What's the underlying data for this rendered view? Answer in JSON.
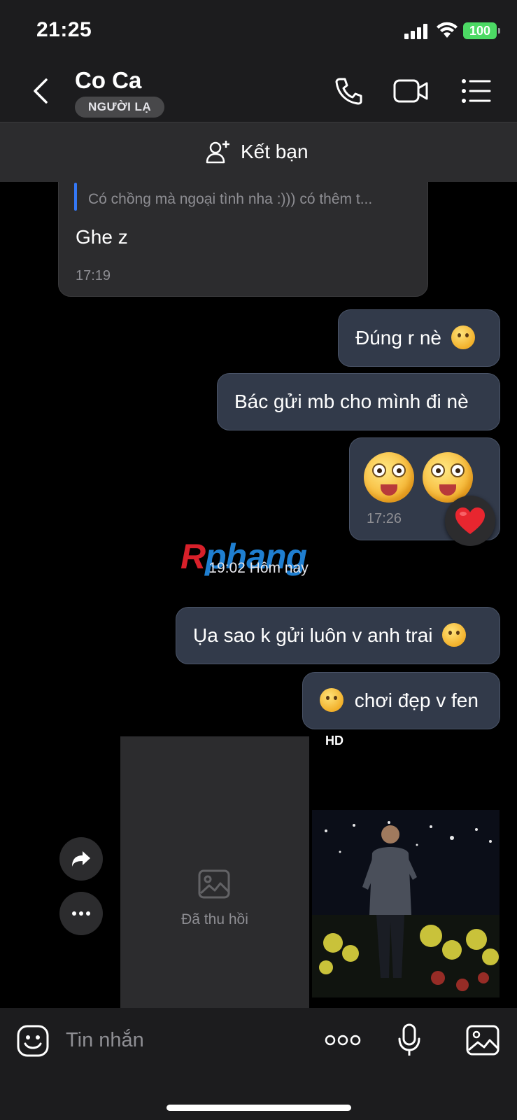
{
  "status_bar": {
    "time": "21:25",
    "battery": "100"
  },
  "header": {
    "contact_name": "Co Ca",
    "badge": "NGƯỜI LẠ",
    "icons": [
      "back-icon",
      "phone-icon",
      "video-call-icon",
      "menu-list-icon"
    ]
  },
  "add_friend": {
    "label": "Kết bạn",
    "icon": "add-person-icon"
  },
  "messages": {
    "incoming": {
      "quote": "Có chồng mà ngoại tình nha :))) có thêm t...",
      "text": "Ghe z",
      "time": "17:19"
    },
    "outgoing_1": {
      "text": "Đúng r nè",
      "emoji": "shushing-face"
    },
    "outgoing_2": {
      "text": "Bác gửi mb cho mình đi nè"
    },
    "outgoing_3": {
      "emojis": [
        "drooling-face",
        "drooling-face"
      ],
      "time": "17:26",
      "reaction": "heart"
    },
    "date_separator": "19:02 Hôm nay",
    "outgoing_4": {
      "text": "Ụa sao k gửi luôn v anh trai",
      "emoji": "thinking-face"
    },
    "outgoing_5": {
      "text": "chơi đẹp v fen",
      "emoji": "smiling-face"
    },
    "recalled": {
      "label": "Đã thu hồi"
    },
    "photo": {
      "quality": "HD"
    }
  },
  "watermark": {
    "first": "R",
    "rest": "phang"
  },
  "composer": {
    "placeholder": "Tin nhắn",
    "icons": [
      "sticker-icon",
      "more-icon",
      "microphone-icon",
      "image-icon"
    ]
  },
  "colors": {
    "outgoing_bubble": "#323a4a",
    "incoming_bubble": "#2c2c2e",
    "accent": "#3478f6",
    "battery": "#4cd964"
  }
}
